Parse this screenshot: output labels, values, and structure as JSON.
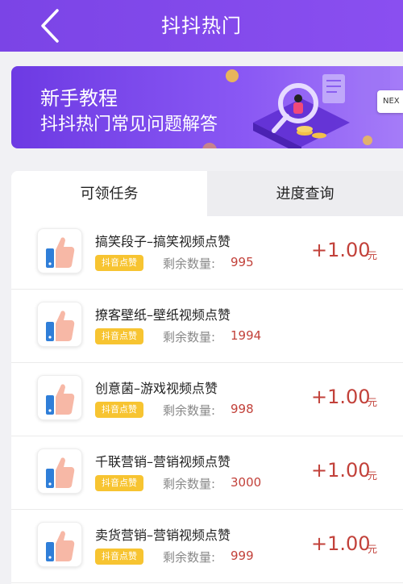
{
  "header": {
    "title": "抖抖热门",
    "back_icon": "chevron-left-icon"
  },
  "banner": {
    "title": "新手教程",
    "subtitle": "抖抖热门常见问题解答",
    "next_label": "NEX",
    "illustration": "magnifier-reading-illustration"
  },
  "tabs": [
    {
      "label": "可领任务",
      "active": true
    },
    {
      "label": "进度查询",
      "active": false
    }
  ],
  "tasks": [
    {
      "name": "搞笑段子–搞笑视频点赞",
      "tag": "抖音点赞",
      "remaining_label": "剩余数量:",
      "remaining": "995",
      "reward": "+1.00",
      "unit": "元"
    },
    {
      "name": "撩客壁纸–壁纸视频点赞",
      "tag": "抖音点赞",
      "remaining_label": "剩余数量:",
      "remaining": "1994",
      "reward": "",
      "unit": ""
    },
    {
      "name": "创意菌–游戏视频点赞",
      "tag": "抖音点赞",
      "remaining_label": "剩余数量:",
      "remaining": "998",
      "reward": "+1.00",
      "unit": "元"
    },
    {
      "name": "千联营销–营销视频点赞",
      "tag": "抖音点赞",
      "remaining_label": "剩余数量:",
      "remaining": "3000",
      "reward": "+1.00",
      "unit": "元"
    },
    {
      "name": "卖货营销–营销视频点赞",
      "tag": "抖音点赞",
      "remaining_label": "剩余数量:",
      "remaining": "999",
      "reward": "+1.00",
      "unit": "元"
    }
  ],
  "colors": {
    "header_purple": "#7b44e6",
    "accent_red": "#c2413a",
    "tag_yellow": "#f7c431"
  }
}
